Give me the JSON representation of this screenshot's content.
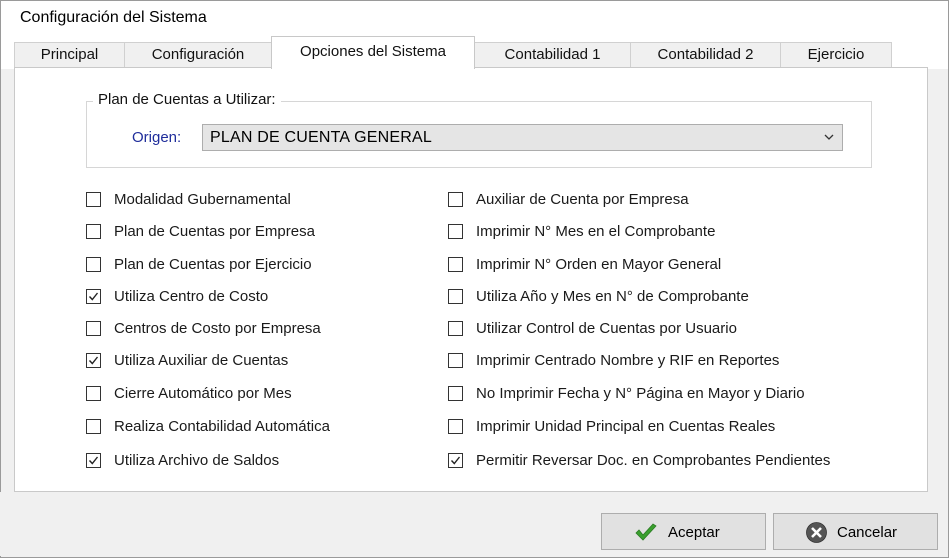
{
  "window": {
    "title": "Configuración del Sistema"
  },
  "tabs": [
    {
      "label": "Principal",
      "active": false
    },
    {
      "label": "Configuración",
      "active": false
    },
    {
      "label": "Opciones del Sistema",
      "active": true
    },
    {
      "label": "Contabilidad 1",
      "active": false
    },
    {
      "label": "Contabilidad 2",
      "active": false
    },
    {
      "label": "Ejercicio",
      "active": false
    }
  ],
  "plan_group": {
    "legend": "Plan de Cuentas a Utilizar:",
    "origen_label": "Origen:",
    "origen_value": "PLAN DE CUENTA GENERAL"
  },
  "left_options": [
    {
      "label": "Modalidad Gubernamental",
      "checked": false
    },
    {
      "label": "Plan de Cuentas por Empresa",
      "checked": false
    },
    {
      "label": "Plan de Cuentas por Ejercicio",
      "checked": false
    },
    {
      "label": "Utiliza Centro de Costo",
      "checked": true
    },
    {
      "label": "Centros de Costo por Empresa",
      "checked": false
    },
    {
      "label": "Utiliza Auxiliar de Cuentas",
      "checked": true
    },
    {
      "label": "Cierre Automático por Mes",
      "checked": false
    },
    {
      "label": "Realiza Contabilidad Automática",
      "checked": false
    },
    {
      "label": "Utiliza Archivo de Saldos",
      "checked": true
    }
  ],
  "right_options": [
    {
      "label": "Auxiliar de Cuenta por Empresa",
      "checked": false
    },
    {
      "label": "Imprimir N° Mes en el Comprobante",
      "checked": false
    },
    {
      "label": "Imprimir N° Orden en Mayor General",
      "checked": false
    },
    {
      "label": "Utiliza Año y Mes en N° de Comprobante",
      "checked": false
    },
    {
      "label": "Utilizar Control de Cuentas por Usuario",
      "checked": false
    },
    {
      "label": "Imprimir Centrado Nombre y RIF en Reportes",
      "checked": false
    },
    {
      "label": "No Imprimir Fecha y N° Página en Mayor y Diario",
      "checked": false
    },
    {
      "label": "Imprimir Unidad Principal en Cuentas Reales",
      "checked": false
    },
    {
      "label": "Permitir Reversar Doc. en Comprobantes Pendientes",
      "checked": true
    }
  ],
  "buttons": {
    "accept_label": "Aceptar",
    "cancel_label": "Cancelar"
  },
  "colors": {
    "origen_label": "#1f2d9b",
    "accept_icon": "#3aa02e",
    "cancel_icon": "#555555"
  }
}
